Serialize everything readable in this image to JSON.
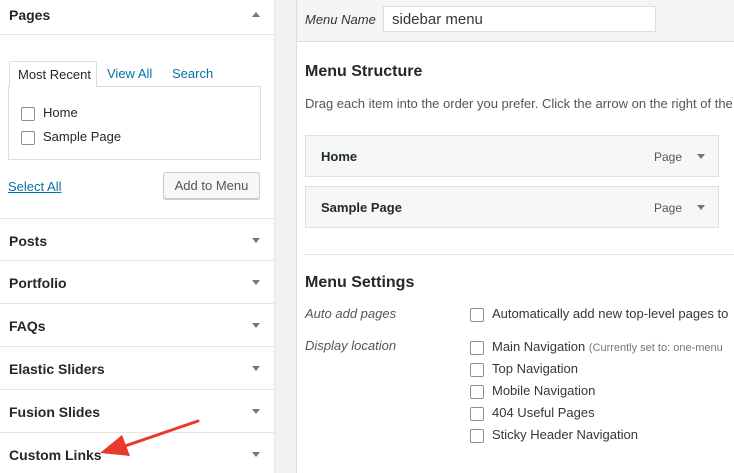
{
  "left_panel": {
    "pages": {
      "title": "Pages",
      "tabs": [
        "Most Recent",
        "View All",
        "Search"
      ],
      "items": [
        "Home",
        "Sample Page"
      ],
      "select_all": "Select All",
      "add_button": "Add to Menu"
    },
    "sections": [
      "Posts",
      "Portfolio",
      "FAQs",
      "Elastic Sliders",
      "Fusion Slides",
      "Custom Links"
    ]
  },
  "menu": {
    "name_label": "Menu Name",
    "name_value": "sidebar menu",
    "structure_title": "Menu Structure",
    "structure_desc": "Drag each item into the order you prefer. Click the arrow on the right of the",
    "items": [
      {
        "title": "Home",
        "type": "Page"
      },
      {
        "title": "Sample Page",
        "type": "Page"
      }
    ],
    "settings_title": "Menu Settings",
    "auto_add_label": "Auto add pages",
    "auto_add_text": "Automatically add new top-level pages to",
    "display_location_label": "Display location",
    "locations": [
      {
        "name": "Main Navigation",
        "note": "(Currently set to: one-menu"
      },
      {
        "name": "Top Navigation",
        "note": ""
      },
      {
        "name": "Mobile Navigation",
        "note": ""
      },
      {
        "name": "404 Useful Pages",
        "note": ""
      },
      {
        "name": "Sticky Header Navigation",
        "note": ""
      }
    ]
  },
  "colors": {
    "link": "#0073aa",
    "annotation_arrow": "#e8392e"
  }
}
